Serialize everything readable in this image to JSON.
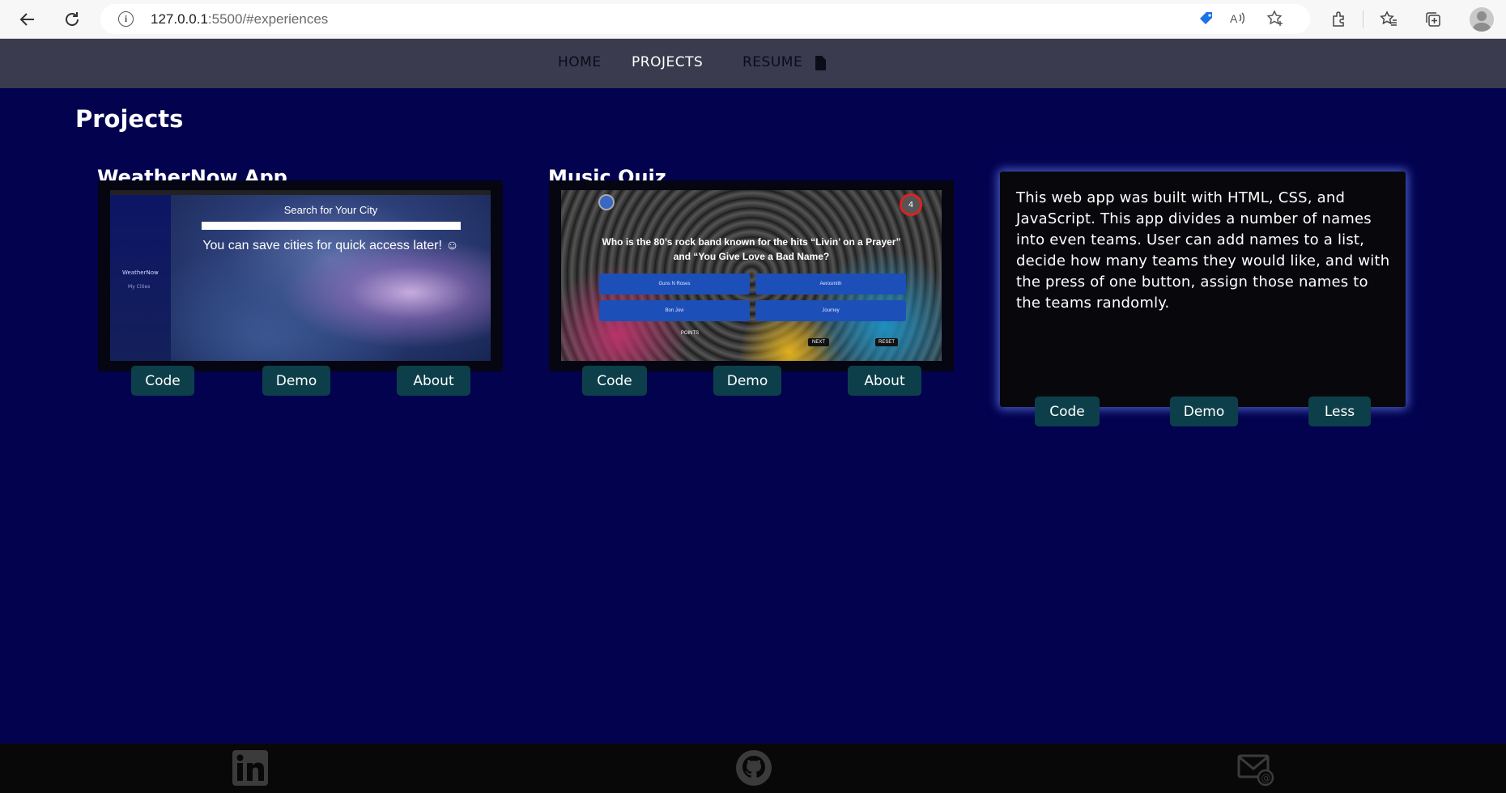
{
  "browser": {
    "url_host": "127.0.0.1",
    "url_rest": ":5500/#experiences"
  },
  "nav": {
    "items": [
      {
        "label": "HOME"
      },
      {
        "label": "PROJECTS"
      },
      {
        "label": "RESUME"
      }
    ]
  },
  "page": {
    "title": "Projects"
  },
  "projects": [
    {
      "title": "WeatherNow App",
      "buttons": {
        "code": "Code",
        "demo": "Demo",
        "about": "About"
      },
      "screenshot": {
        "sidebar_title": "WeatherNow",
        "sidebar_item": "My Cities",
        "heading": "Search for Your City",
        "message": "You can save cities for quick access later! ☺"
      }
    },
    {
      "title": "Music Quiz",
      "buttons": {
        "code": "Code",
        "demo": "Demo",
        "about": "About"
      },
      "screenshot": {
        "question": "Who is the 80’s rock band known for the hits “Livin’ on a Prayer” and “You Give Love a Bad Name?",
        "options": [
          "Guns N Roses",
          "Aerosmith",
          "Bon Jovi",
          "Journey"
        ],
        "next": "NEXT",
        "reset": "RESET",
        "points": "POINTS",
        "badge": "4"
      }
    },
    {
      "description": "This web app was built with HTML, CSS, and JavaScript. This app divides a number of names into even teams. User can add names to a list, decide how many teams they would like, and with the press of one button, assign those names to the teams randomly.",
      "buttons": {
        "code": "Code",
        "demo": "Demo",
        "less": "Less"
      }
    }
  ],
  "colors": {
    "background": "#02024f",
    "nav_bg": "#3a3b4e",
    "button_bg": "#0d3f4a",
    "footer_bg": "#080808",
    "card_glow": "#6e8cff"
  },
  "footer": {
    "icons": [
      "linkedin-icon",
      "github-icon",
      "email-icon"
    ]
  }
}
